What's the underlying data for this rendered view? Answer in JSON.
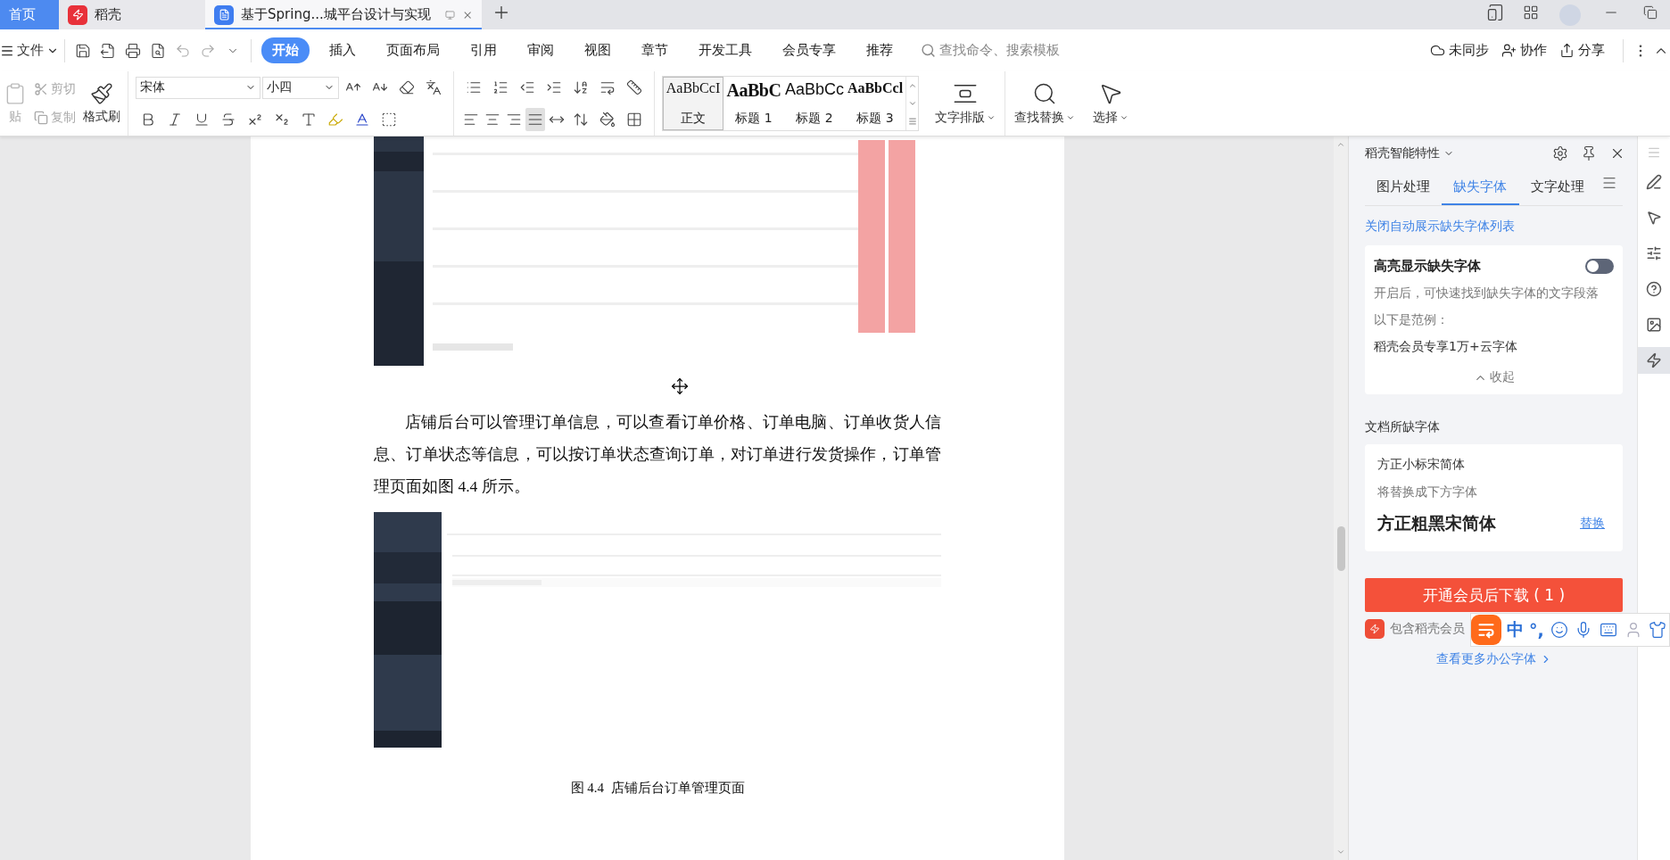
{
  "tabs": [
    {
      "label": "首页",
      "kind": "home",
      "selected": false
    },
    {
      "label": "稻壳",
      "kind": "docer",
      "selected": false
    },
    {
      "label": "基于Spring...城平台设计与实现",
      "kind": "document",
      "selected": true
    }
  ],
  "menu": {
    "file": "文件",
    "tabs": [
      {
        "label": "开始",
        "selected": true
      },
      {
        "label": "插入",
        "selected": false
      },
      {
        "label": "页面布局",
        "selected": false
      },
      {
        "label": "引用",
        "selected": false
      },
      {
        "label": "审阅",
        "selected": false
      },
      {
        "label": "视图",
        "selected": false
      },
      {
        "label": "章节",
        "selected": false
      },
      {
        "label": "开发工具",
        "selected": false
      },
      {
        "label": "会员专享",
        "selected": false
      },
      {
        "label": "推荐",
        "selected": false
      }
    ],
    "search": {
      "placeholder": "查找命令、搜索模板"
    },
    "actions": [
      "未同步",
      "协作",
      "分享"
    ]
  },
  "ribbon": {
    "paste": {
      "label": "贴",
      "disabled": true
    },
    "cut": {
      "label": "剪切",
      "disabled": true
    },
    "copy": {
      "label": "复制",
      "disabled": true
    },
    "format_painter": "格式刷",
    "font": {
      "name": "宋体",
      "size": "小四"
    },
    "styles": [
      {
        "sample": "AaBbCcI",
        "label": "正文",
        "kind": "body",
        "selected": true
      },
      {
        "sample": "AaBbC",
        "label": "标题 1",
        "kind": "h1",
        "selected": false
      },
      {
        "sample": "AaBbCc",
        "label": "标题 2",
        "kind": "h2",
        "selected": false
      },
      {
        "sample": "AaBbCcl",
        "label": "标题 3",
        "kind": "h3",
        "selected": false
      }
    ],
    "tools": [
      "文字排版",
      "查找替换",
      "选择"
    ]
  },
  "document": {
    "blocks": [
      {
        "kind": "picture"
      },
      {
        "kind": "paragraph",
        "text": "店铺后台可以管理订单信息，可以查看订单价格、订单电脑、订单收货人信息、订单状态等信息，可以按订单状态查询订单，对订单进行发货操作，订单管理页面如图 4.4 所示。"
      },
      {
        "kind": "picture"
      },
      {
        "kind": "caption",
        "text": "图 4.4  店铺后台订单管理页面"
      }
    ]
  },
  "panel": {
    "title": "稻壳智能特性",
    "tabs": [
      {
        "label": "图片处理",
        "selected": false
      },
      {
        "label": "缺失字体",
        "selected": true
      },
      {
        "label": "文字处理",
        "selected": false
      }
    ],
    "link": "关闭自动展示缺失字体列表",
    "highlight": {
      "title": "高亮显示缺失字体",
      "on": false,
      "lines": [
        "开启后，可快速找到缺失字体的文字段落",
        "以下是范例：",
        "稻壳会员专享1万+云字体"
      ],
      "collapse": "收起"
    },
    "missing_heading": "文档所缺字体",
    "missing": {
      "font": "方正小标宋简体",
      "hint": "将替换成下方字体",
      "replacement": "方正粗黑宋简体",
      "action": "替换"
    },
    "download": "开通会员后下载 ( 1 )",
    "note": "包含稻壳会员",
    "more": "查看更多办公字体"
  },
  "ime": {
    "mode": "中",
    "punctuation": "°,"
  }
}
